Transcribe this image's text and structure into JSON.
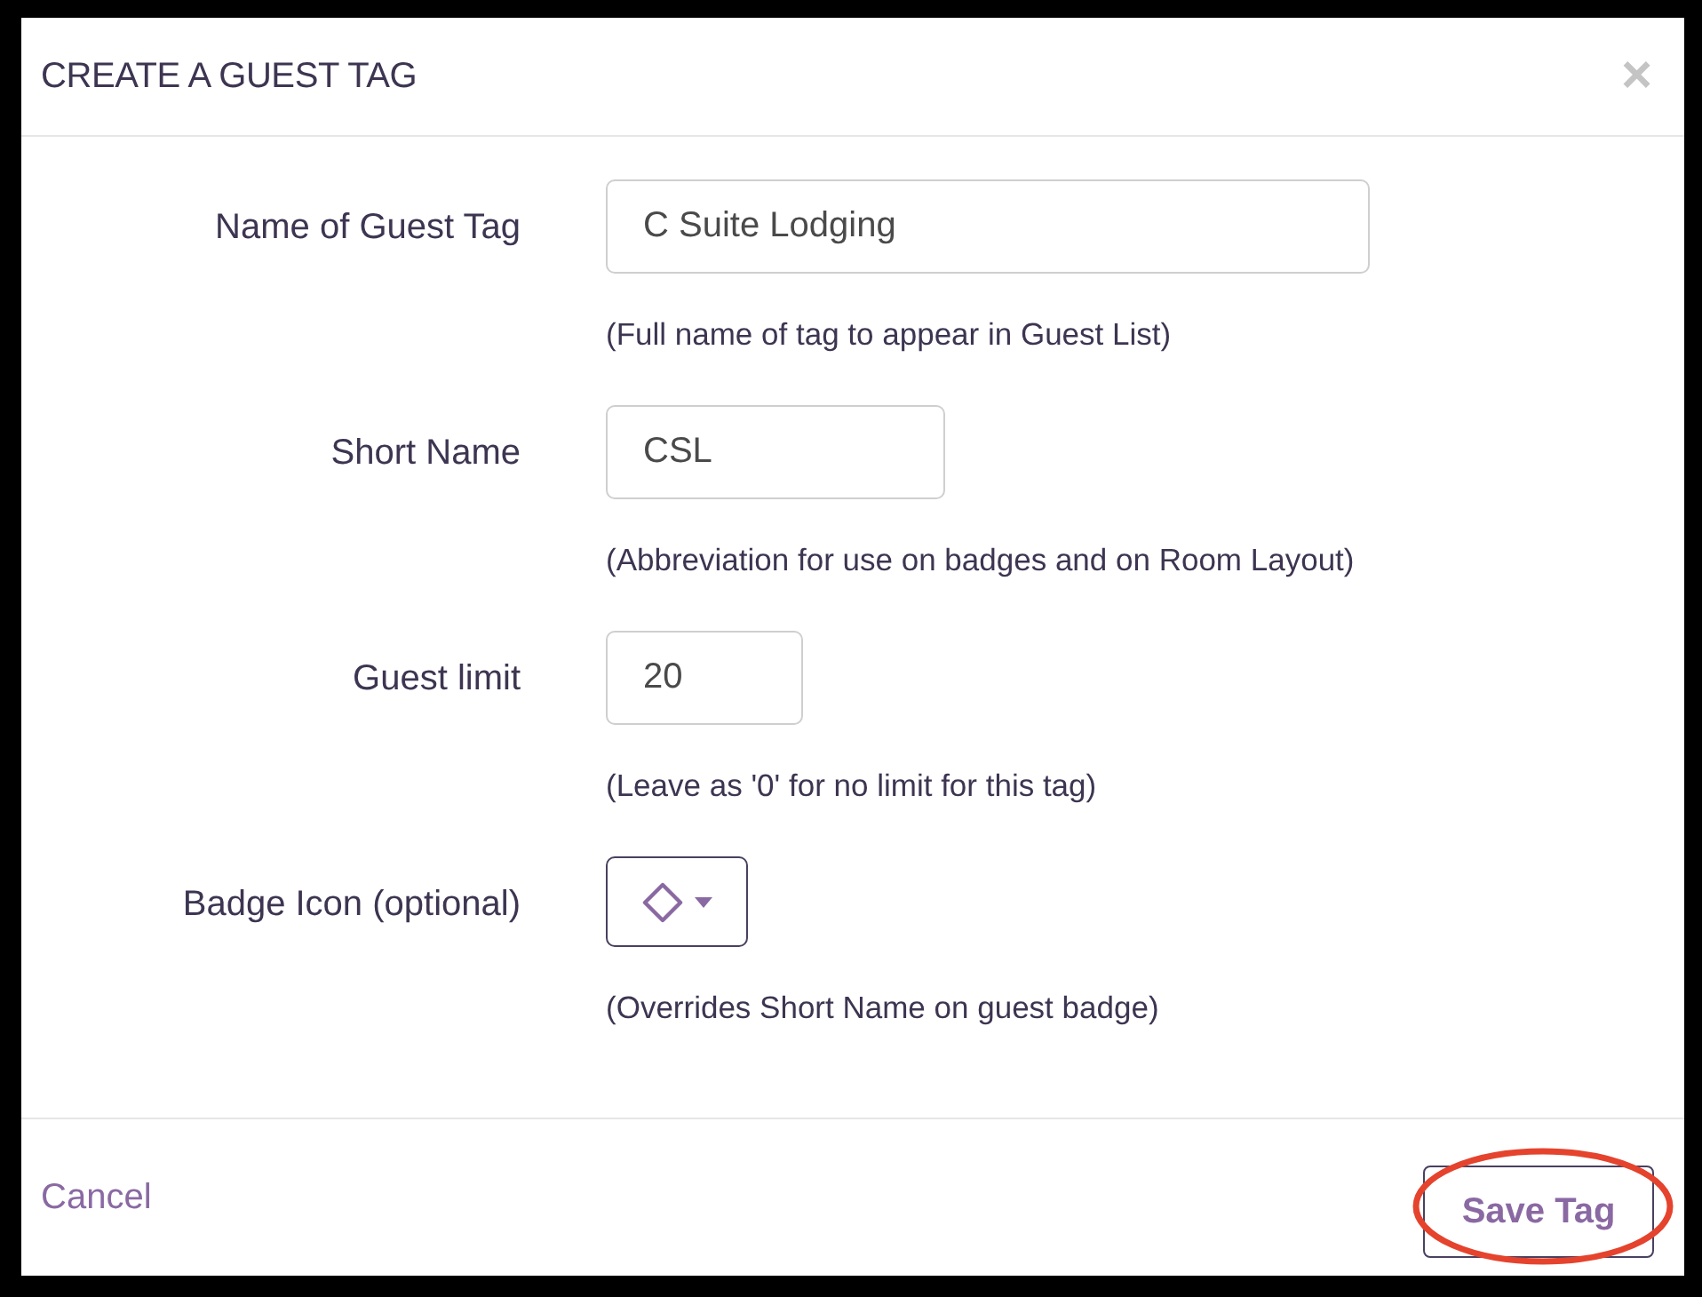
{
  "dialog": {
    "title": "CREATE A GUEST TAG",
    "close": "×"
  },
  "fields": [
    {
      "kind": "text",
      "label": "Name of Guest Tag",
      "value": "C Suite Lodging",
      "help": "(Full name of tag to appear in Guest List)"
    },
    {
      "kind": "text",
      "label": "Short Name",
      "value": "CSL",
      "help": "(Abbreviation for use on badges and on Room Layout)"
    },
    {
      "kind": "number",
      "label": "Guest limit",
      "value": "20",
      "help": "(Leave as '0' for no limit for this tag)"
    },
    {
      "kind": "icon_picker",
      "label": "Badge Icon (optional)",
      "help": "(Overrides Short Name on guest badge)"
    }
  ],
  "footer": {
    "cancel": "Cancel",
    "save_button": {
      "label": "Save Tag",
      "highlighted": true
    }
  }
}
